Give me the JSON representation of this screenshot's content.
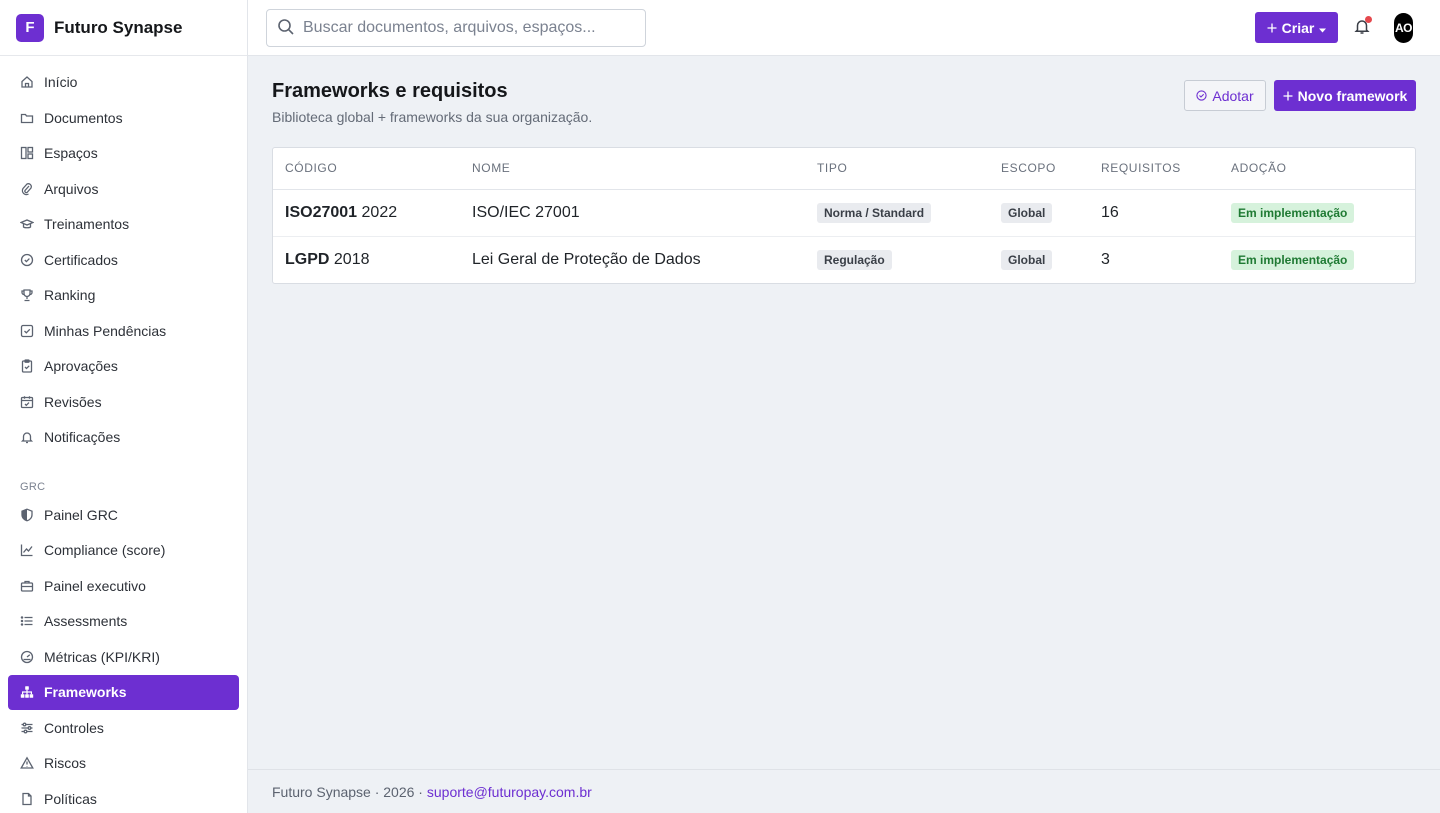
{
  "brand": {
    "logo_letter": "F",
    "name": "Futuro Synapse"
  },
  "sidebar": {
    "items": [
      {
        "label": "Início",
        "icon": "home-icon"
      },
      {
        "label": "Documentos",
        "icon": "folder-icon"
      },
      {
        "label": "Espaços",
        "icon": "layout-icon"
      },
      {
        "label": "Arquivos",
        "icon": "paperclip-icon"
      },
      {
        "label": "Treinamentos",
        "icon": "graduation-cap-icon"
      },
      {
        "label": "Certificados",
        "icon": "badge-check-icon"
      },
      {
        "label": "Ranking",
        "icon": "trophy-icon"
      },
      {
        "label": "Minhas Pendências",
        "icon": "checkbox-icon"
      },
      {
        "label": "Aprovações",
        "icon": "clipboard-check-icon"
      },
      {
        "label": "Revisões",
        "icon": "calendar-check-icon"
      },
      {
        "label": "Notificações",
        "icon": "bell-icon"
      }
    ],
    "section_grc": "GRC",
    "grc_items": [
      {
        "label": "Painel GRC",
        "icon": "shield-icon"
      },
      {
        "label": "Compliance (score)",
        "icon": "trend-chart-icon"
      },
      {
        "label": "Painel executivo",
        "icon": "briefcase-icon"
      },
      {
        "label": "Assessments",
        "icon": "list-icon"
      },
      {
        "label": "Métricas (KPI/KRI)",
        "icon": "gauge-icon"
      },
      {
        "label": "Frameworks",
        "icon": "network-icon",
        "active": true
      },
      {
        "label": "Controles",
        "icon": "sliders-icon"
      },
      {
        "label": "Riscos",
        "icon": "warning-icon"
      },
      {
        "label": "Políticas",
        "icon": "file-icon"
      }
    ]
  },
  "topbar": {
    "search_placeholder": "Buscar documentos, arquivos, espaços...",
    "create_label": "Criar",
    "avatar_initials": "AO",
    "notification_dot_color": "#e5484d"
  },
  "page": {
    "title": "Frameworks e requisitos",
    "subtitle": "Biblioteca global + frameworks da sua organização.",
    "adopt_label": "Adotar",
    "new_label": "Novo framework"
  },
  "table": {
    "headers": [
      "CÓDIGO",
      "NOME",
      "TIPO",
      "ESCOPO",
      "REQUISITOS",
      "ADOÇÃO"
    ],
    "rows": [
      {
        "code": "ISO27001",
        "version": "2022",
        "name": "ISO/IEC 27001",
        "type": "Norma / Standard",
        "scope": "Global",
        "requirements": "16",
        "adoption": "Em implementação"
      },
      {
        "code": "LGPD",
        "version": "2018",
        "name": "Lei Geral de Proteção de Dados",
        "type": "Regulação",
        "scope": "Global",
        "requirements": "3",
        "adoption": "Em implementação"
      }
    ]
  },
  "footer": {
    "text": "Futuro Synapse · 2026 · ",
    "email": "suporte@futuropay.com.br"
  },
  "colors": {
    "accent": "#6d2fd1",
    "success_bg": "#d6f2dc",
    "success_text": "#1f7a33"
  }
}
